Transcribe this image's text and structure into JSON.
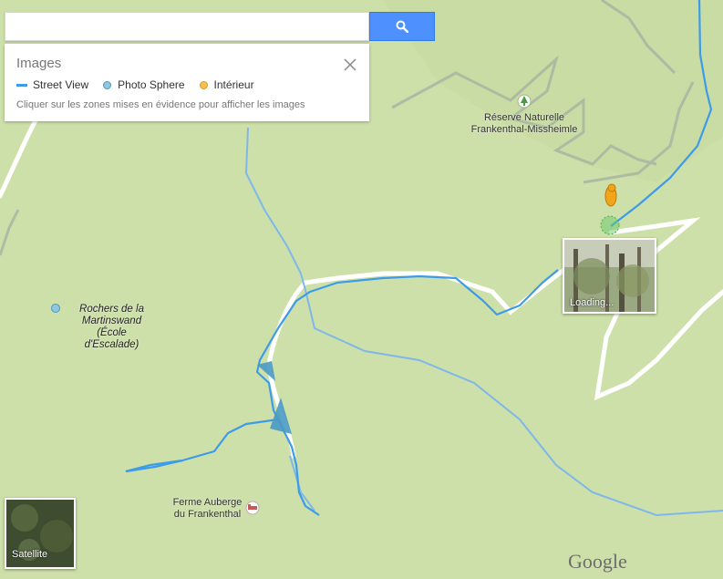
{
  "search": {
    "value": "",
    "placeholder": "",
    "button_icon": "search-icon"
  },
  "panel": {
    "title": "Images",
    "legend": [
      {
        "label": "Street View",
        "icon": "street-view-line"
      },
      {
        "label": "Photo Sphere",
        "icon": "photo-sphere-dot",
        "color": "#8ec7df"
      },
      {
        "label": "Intérieur",
        "icon": "interior-dot",
        "color": "#f9c24c"
      }
    ],
    "hint": "Cliquer sur les zones mises en évidence pour afficher les images"
  },
  "places": {
    "reserve": "Réserve Naturelle\nFrankenthal-Missheimle",
    "rochers": "Rochers de la\nMartinswand\n(École\nd'Escalade)",
    "ferme": "Ferme Auberge\ndu Frankenthal"
  },
  "preview": {
    "label": "Loading..."
  },
  "satellite": {
    "label": "Satellite"
  },
  "brand": "Google",
  "colors": {
    "map_bg": "#cde0a9",
    "street_view": "#3d9be9",
    "search_button": "#4d90fe"
  }
}
